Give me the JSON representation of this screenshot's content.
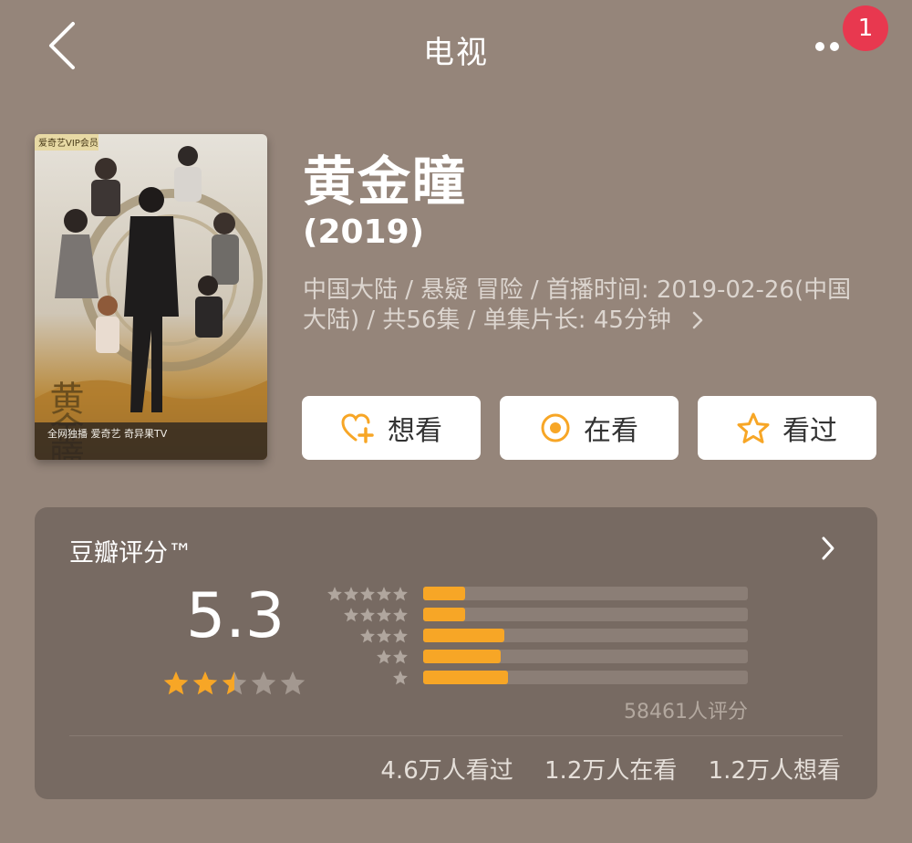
{
  "header": {
    "title": "电视",
    "badge": "1"
  },
  "show": {
    "title": "黄金瞳",
    "year": "(2019)",
    "meta_line1": "中国大陆 / 悬疑 冒险 / 首播时间: 2019-02-26(中国",
    "meta_line2": "大陆) / 共56集 / 单集片长: 45分钟",
    "poster": {
      "corner_tag": "爱奇艺VIP会员",
      "title_art": "黄金瞳",
      "footer": "全网独播 爱奇艺 奇异果TV"
    }
  },
  "actions": {
    "want": {
      "label": "想看",
      "icon": "heart-plus-icon"
    },
    "watching": {
      "label": "在看",
      "icon": "target-icon"
    },
    "watched": {
      "label": "看过",
      "icon": "star-outline-icon"
    }
  },
  "rating": {
    "title": "豆瓣评分™",
    "score": "5.3",
    "stars_value": 2.5,
    "count": "58461人评分",
    "distribution": [
      {
        "stars": 5,
        "fraction": 0.13
      },
      {
        "stars": 4,
        "fraction": 0.13
      },
      {
        "stars": 3,
        "fraction": 0.25
      },
      {
        "stars": 2,
        "fraction": 0.24
      },
      {
        "stars": 1,
        "fraction": 0.26
      }
    ]
  },
  "stats": {
    "watched": "4.6万人看过",
    "watching": "1.2万人在看",
    "want": "1.2万人想看"
  },
  "colors": {
    "background": "#95857a",
    "card": "#776a62",
    "accent": "#f7a626",
    "badge": "#e8384f"
  }
}
